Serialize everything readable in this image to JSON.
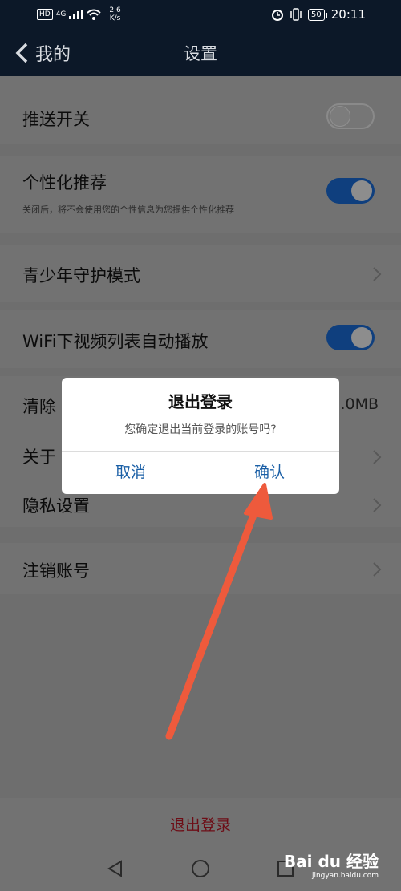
{
  "status_bar": {
    "hd": "HD",
    "network": "4G",
    "speed_value": "2.6",
    "speed_unit": "K/s",
    "battery": "50",
    "time": "20:11"
  },
  "header": {
    "back_label": "我的",
    "title": "设置"
  },
  "settings": {
    "push_toggle": {
      "label": "推送开关",
      "state": "off"
    },
    "personalized": {
      "label": "个性化推荐",
      "subtitle": "关闭后，将不会使用您的个性信息为您提供个性化推荐",
      "state": "on"
    },
    "teen_mode": {
      "label": "青少年守护模式"
    },
    "wifi_autoplay": {
      "label": "WiFi下视频列表自动播放",
      "state": "on"
    },
    "clear_cache": {
      "label_visible": "清除",
      "size_visible": ".0MB"
    },
    "about": {
      "label_visible": "关于"
    },
    "privacy": {
      "label": "隐私设置"
    },
    "deactivate": {
      "label": "注销账号"
    }
  },
  "logout_button": "退出登录",
  "dialog": {
    "title": "退出登录",
    "message": "您确定退出当前登录的账号吗?",
    "cancel": "取消",
    "confirm": "确认"
  },
  "watermark": {
    "brand": "Bai du 经验",
    "url": "jingyan.baidu.com"
  },
  "colors": {
    "header_bg": "#0c1828",
    "toggle_on": "#0f3f7e",
    "dialog_button": "#1a5fa6",
    "logout_text": "#6d0d16",
    "annotation_arrow": "#ee5a3c"
  }
}
